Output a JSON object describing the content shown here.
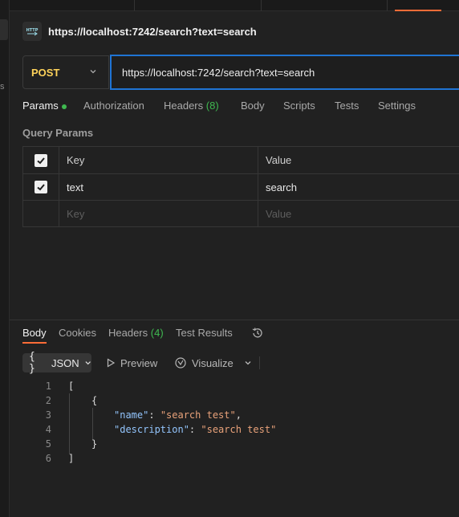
{
  "left_strip": {
    "letter": "s"
  },
  "request": {
    "title": "https://localhost:7242/search?text=search",
    "method": "POST",
    "url": "https://localhost:7242/search?text=search"
  },
  "request_tabs": [
    {
      "label": "Params",
      "active": true
    },
    {
      "label": "Authorization"
    },
    {
      "label": "Headers",
      "count": "(8)"
    },
    {
      "label": "Body"
    },
    {
      "label": "Scripts"
    },
    {
      "label": "Tests"
    },
    {
      "label": "Settings"
    }
  ],
  "query_params": {
    "label": "Query Params",
    "headers": {
      "key": "Key",
      "value": "Value"
    },
    "rows": [
      {
        "key": "text",
        "value": "search",
        "checked": true
      }
    ],
    "placeholder": {
      "key": "Key",
      "value": "Value"
    }
  },
  "response_tabs": [
    {
      "label": "Body",
      "active": true
    },
    {
      "label": "Cookies"
    },
    {
      "label": "Headers",
      "count": "(4)"
    },
    {
      "label": "Test Results"
    }
  ],
  "response_toolbar": {
    "format_icon": "{ }",
    "format": "JSON",
    "preview": "Preview",
    "visualize": "Visualize"
  },
  "response_body": {
    "line_numbers": [
      "1",
      "2",
      "3",
      "4",
      "5",
      "6"
    ],
    "lines": [
      "[",
      "{",
      "\"name\"",
      "\"search test\"",
      "\"description\"",
      "\"search test\"",
      "}",
      "]"
    ]
  },
  "colors": {
    "accent": "#ff6c37",
    "method_post": "#ffd35a",
    "url_focus": "#1f74d4",
    "count_green": "#3fb950",
    "json_key": "#93c5fd",
    "json_string": "#e9a27a"
  }
}
